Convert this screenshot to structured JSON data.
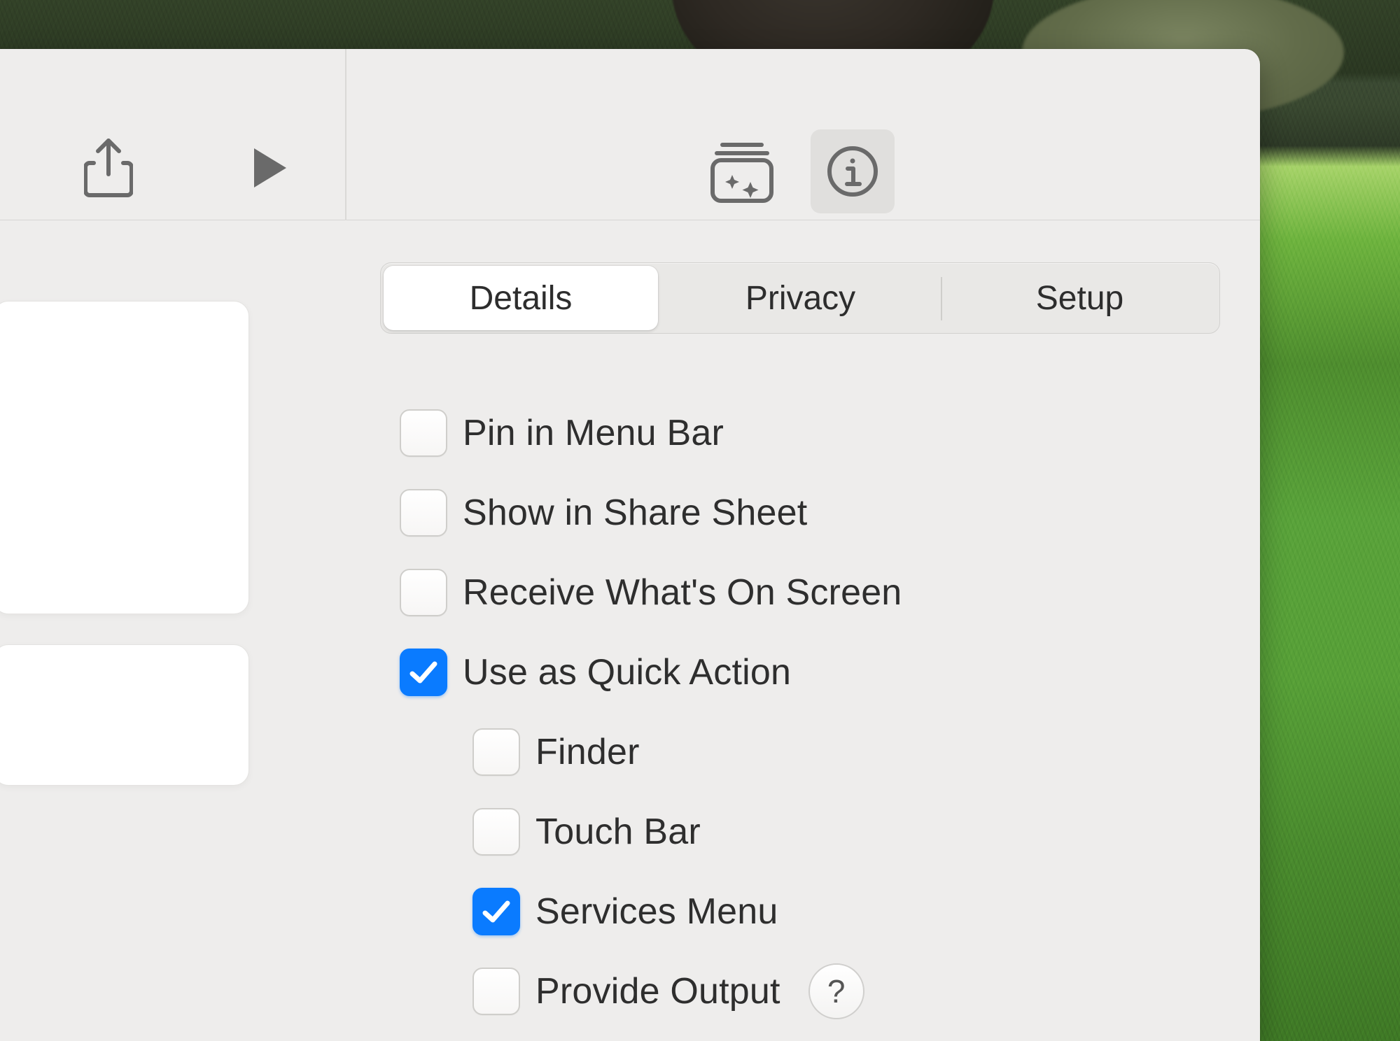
{
  "tabs": {
    "details": "Details",
    "privacy": "Privacy",
    "setup": "Setup",
    "selected": "details"
  },
  "options": {
    "pin_menu_bar": {
      "label": "Pin in Menu Bar",
      "checked": false
    },
    "share_sheet": {
      "label": "Show in Share Sheet",
      "checked": false
    },
    "receive_screen": {
      "label": "Receive What's On Screen",
      "checked": false
    },
    "quick_action": {
      "label": "Use as Quick Action",
      "checked": true
    },
    "finder": {
      "label": "Finder",
      "checked": false
    },
    "touch_bar": {
      "label": "Touch Bar",
      "checked": false
    },
    "services_menu": {
      "label": "Services Menu",
      "checked": true
    },
    "provide_output": {
      "label": "Provide Output",
      "checked": false
    }
  },
  "help_label": "?",
  "icons": {
    "share": "share-icon",
    "play": "play-icon",
    "stack": "stack-sparkle-icon",
    "info": "info-icon"
  }
}
